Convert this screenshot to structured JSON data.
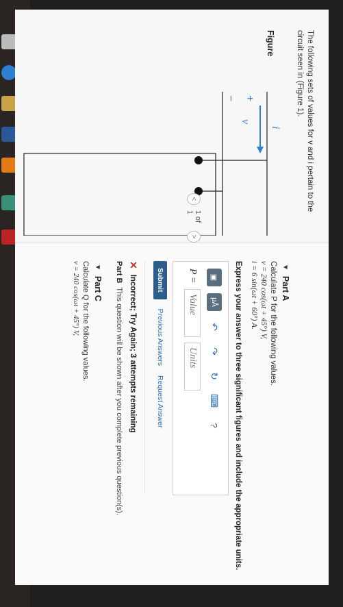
{
  "intro": {
    "line1": "The following sets of values for v and i pertain to the",
    "line2": "circuit seen in (Figure 1)."
  },
  "figure": {
    "title": "Figure",
    "current_label": "i",
    "plus": "+",
    "voltage_label": "v",
    "minus": "−",
    "pager": "1 of 1"
  },
  "partA": {
    "title": "Part A",
    "prompt": "Calculate P for the following values.",
    "v_eq": "v = 240 cos(ωt + 45°) V,",
    "i_eq": "i = 6 sin(ωt + 60°) A.",
    "instruction": "Express your answer to three significant figures and include the appropriate units.",
    "answer_label": "P =",
    "value_placeholder": "Value",
    "units_placeholder": "Units",
    "tools": {
      "templates": "▣",
      "mu": "μÅ",
      "undo": "↶",
      "redo": "↷",
      "reset": "↻",
      "keyboard": "⌨",
      "help": "?"
    },
    "submit_label": "Submit",
    "previous_answers": "Previous Answers",
    "request_answer": "Request Answer",
    "feedback_icon": "✕",
    "feedback": "Incorrect; Try Again; 3 attempts remaining"
  },
  "partB": {
    "title": "Part B",
    "text": "This question will be shown after you complete previous question(s)."
  },
  "partC": {
    "title": "Part C",
    "prompt": "Calculate Q for the following values.",
    "v_eq": "v = 240 cos(ωt + 45°) V,"
  }
}
